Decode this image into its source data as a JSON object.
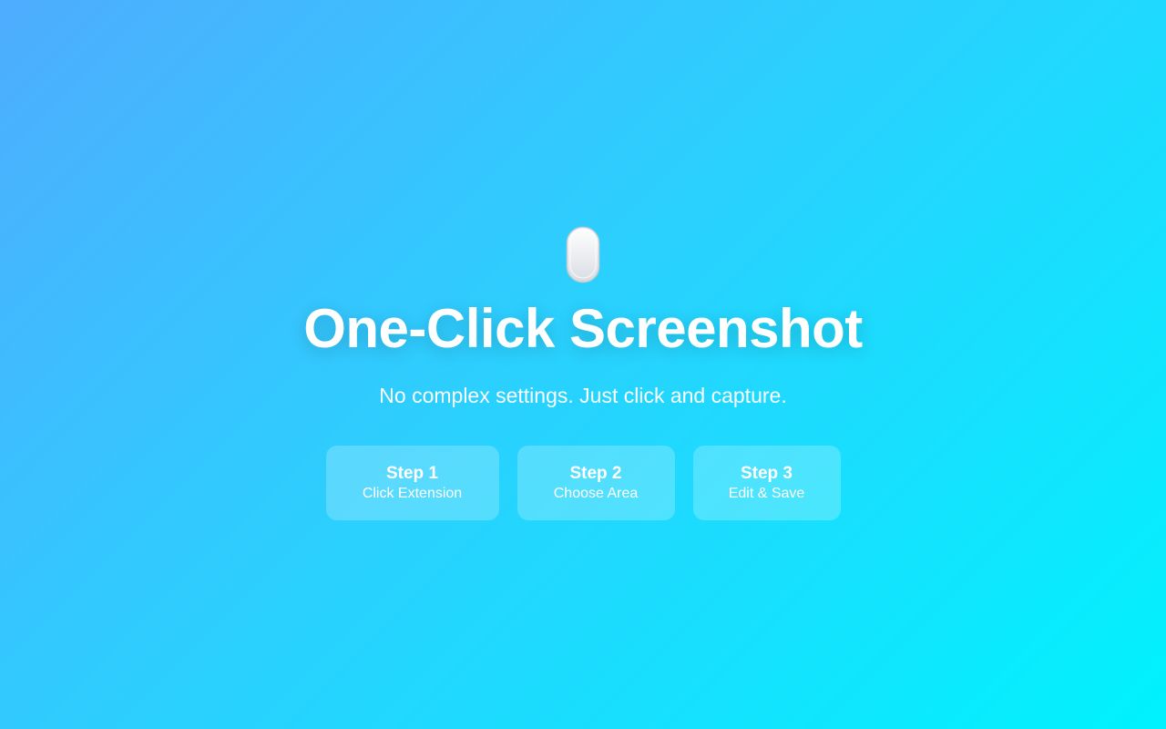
{
  "hero": {
    "icon": "mouse-icon",
    "title": "One-Click Screenshot",
    "subtitle": "No complex settings. Just click and capture."
  },
  "steps": [
    {
      "title": "Step 1",
      "description": "Click Extension"
    },
    {
      "title": "Step 2",
      "description": "Choose Area"
    },
    {
      "title": "Step 3",
      "description": "Edit & Save"
    }
  ],
  "colors": {
    "gradient_start": "#4facfe",
    "gradient_end": "#00f2fe",
    "text": "#ffffff"
  }
}
